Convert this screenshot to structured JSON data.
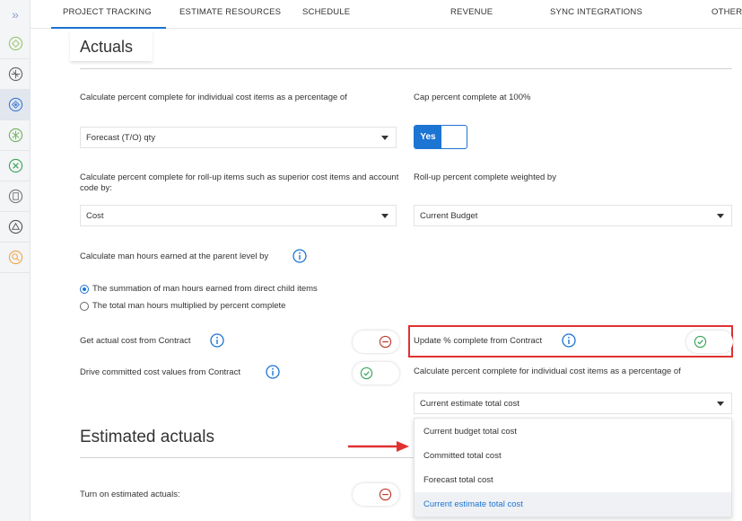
{
  "rail": {
    "expand_glyph": "»",
    "items": [
      {
        "icon": "module-icon-1",
        "active": false
      },
      {
        "icon": "module-icon-2",
        "active": false
      },
      {
        "icon": "module-icon-3",
        "active": true
      },
      {
        "icon": "module-icon-4",
        "active": false
      },
      {
        "icon": "module-icon-5",
        "active": false
      },
      {
        "icon": "module-icon-6",
        "active": false
      },
      {
        "icon": "module-icon-7",
        "active": false
      },
      {
        "icon": "module-icon-8",
        "active": false
      }
    ]
  },
  "tabs": [
    {
      "label": "PROJECT TRACKING",
      "active": true
    },
    {
      "label": "ESTIMATE RESOURCES",
      "active": false
    },
    {
      "label": "SCHEDULE",
      "active": false
    },
    {
      "label": "REVENUE",
      "active": false
    },
    {
      "label": "SYNC INTEGRATIONS",
      "active": false
    },
    {
      "label": "OTHERS",
      "active": false
    }
  ],
  "actuals": {
    "title": "Actuals",
    "pct_individual_label": "Calculate percent complete for individual cost items as a percentage of",
    "pct_individual_value": "Forecast (T/O) qty",
    "cap_label": "Cap percent complete at 100%",
    "cap_value": "Yes",
    "rollup_label": "Calculate percent complete for roll-up items such as superior cost items and account code by:",
    "rollup_value": "Cost",
    "weighted_label": "Roll-up percent complete weighted by",
    "weighted_value": "Current Budget",
    "manhours_label": "Calculate man hours earned at the parent level by",
    "radio_options": [
      {
        "label": "The summation of man hours earned from direct child items",
        "checked": true
      },
      {
        "label": "The total man hours multiplied by percent complete",
        "checked": false
      }
    ],
    "actual_cost_label": "Get actual cost from Contract",
    "actual_cost_on": false,
    "committed_label": "Drive committed cost values from Contract",
    "committed_on": true,
    "update_pct_label": "Update % complete from Contract",
    "update_pct_on": true,
    "calc_pct_label": "Calculate percent complete for individual cost items as a percentage of",
    "calc_pct_value": "Current estimate total cost",
    "calc_pct_options": [
      {
        "label": "Current budget total cost",
        "selected": false
      },
      {
        "label": "Committed total cost",
        "selected": false
      },
      {
        "label": "Forecast total cost",
        "selected": false
      },
      {
        "label": "Current estimate total cost",
        "selected": true
      }
    ]
  },
  "estimated_actuals": {
    "title": "Estimated actuals",
    "turn_on_label": "Turn on estimated actuals:",
    "turn_on_on": false
  },
  "colors": {
    "accent": "#1c74d3",
    "highlight": "#e03131",
    "on_green": "#3aa55a",
    "off_red": "#c0392b"
  }
}
